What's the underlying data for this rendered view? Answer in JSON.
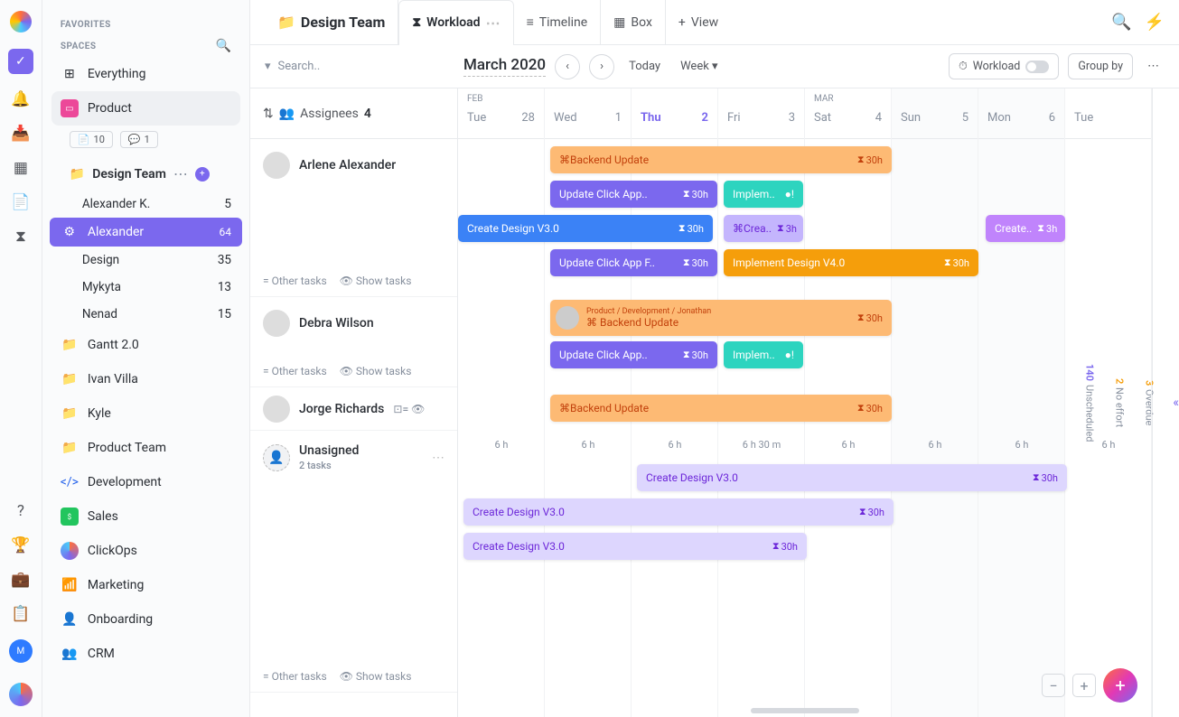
{
  "sidebar": {
    "favorites_label": "FAVORITES",
    "spaces_label": "SPACES",
    "everything_label": "Everything",
    "product_label": "Product",
    "design_team_label": "Design Team",
    "badge_docs": "10",
    "badge_chats": "1",
    "items": [
      {
        "label": "Alexander K.",
        "count": "5"
      },
      {
        "label": "Alexander",
        "count": "64"
      },
      {
        "label": "Design",
        "count": "35"
      },
      {
        "label": "Mykyta",
        "count": "13"
      },
      {
        "label": "Nenad",
        "count": "15"
      }
    ],
    "folders": [
      {
        "label": "Gantt 2.0"
      },
      {
        "label": "Ivan Villa"
      },
      {
        "label": "Kyle"
      },
      {
        "label": "Product Team"
      }
    ],
    "spaces": [
      {
        "label": "Development"
      },
      {
        "label": "Sales"
      },
      {
        "label": "ClickOps"
      },
      {
        "label": "Marketing"
      },
      {
        "label": "Onboarding"
      },
      {
        "label": "CRM"
      }
    ]
  },
  "header": {
    "title": "Design Team",
    "tabs": [
      {
        "label": "Workload"
      },
      {
        "label": "Timeline"
      },
      {
        "label": "Box"
      },
      {
        "label": "View"
      }
    ]
  },
  "toolbar": {
    "search_placeholder": "Search..",
    "period": "March 2020",
    "today_label": "Today",
    "week_label": "Week",
    "workload_label": "Workload",
    "groupby_label": "Group by"
  },
  "assignees": {
    "head_label": "Assignees",
    "head_count": "4",
    "other_tasks": "= Other tasks",
    "show_tasks": "Show tasks",
    "people": [
      {
        "name": "Arlene Alexander"
      },
      {
        "name": "Debra Wilson"
      },
      {
        "name": "Jorge Richards"
      },
      {
        "name": "Unasigned",
        "sub": "2 tasks"
      }
    ]
  },
  "calendar": {
    "days": [
      {
        "month": "FEB",
        "dow": "Tue",
        "num": "28"
      },
      {
        "month": "",
        "dow": "Wed",
        "num": "1"
      },
      {
        "month": "",
        "dow": "Thu",
        "num": "2",
        "today": true
      },
      {
        "month": "",
        "dow": "Fri",
        "num": "3"
      },
      {
        "month": "MAR",
        "dow": "Sat",
        "num": "4"
      },
      {
        "month": "",
        "dow": "Sun",
        "num": "5"
      },
      {
        "month": "",
        "dow": "Mon",
        "num": "6"
      },
      {
        "month": "",
        "dow": "Tue",
        "num": ""
      }
    ],
    "hours": [
      "6 h",
      "6 h",
      "6 h",
      "6 h 30 m",
      "6 h",
      "6 h",
      "6 h",
      "6 h"
    ]
  },
  "tasks": {
    "a1": {
      "label": "Backend Update",
      "time": "30h"
    },
    "a2": {
      "label": "Update Click App..",
      "time": "30h"
    },
    "a3": {
      "label": "Implem..",
      "time": ""
    },
    "a4": {
      "label": "Create Design V3.0",
      "time": "30h"
    },
    "a5": {
      "label": "Crea..",
      "time": "3h"
    },
    "a6": {
      "label": "Update Click App F..",
      "time": "30h"
    },
    "a7": {
      "label": "Implement Design V4.0",
      "time": "30h"
    },
    "a8": {
      "label": "Create..",
      "time": "3h"
    },
    "b1": {
      "path": "Product / Development / Jonathan",
      "label": "Backend Update",
      "time": "30h"
    },
    "b2": {
      "label": "Update Click App..",
      "time": "30h"
    },
    "b3": {
      "label": "Implem..",
      "time": ""
    },
    "c1": {
      "label": "Backend Update",
      "time": "30h"
    },
    "u1": {
      "label": "Create Design V3.0",
      "time": "30h"
    },
    "u2": {
      "label": "Create Design V3.0",
      "time": "30h"
    },
    "u3": {
      "label": "Create Design V3.0",
      "time": "30h"
    }
  },
  "right_rail": {
    "overdue": {
      "n": "3",
      "label": "Overdue"
    },
    "noeffort": {
      "n": "2",
      "label": "No effort"
    },
    "unscheduled": {
      "n": "140",
      "label": "Unscheduled"
    }
  }
}
